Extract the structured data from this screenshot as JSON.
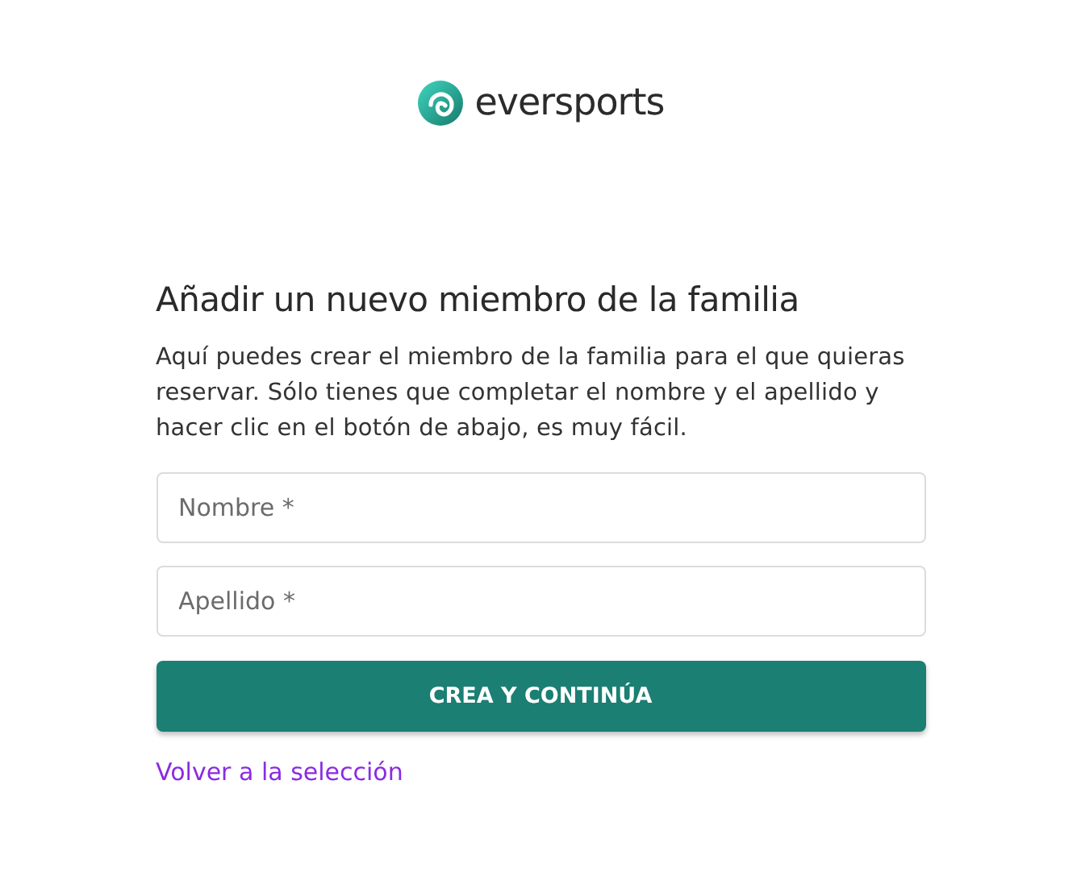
{
  "brand": {
    "name": "eversports"
  },
  "heading": "Añadir un nuevo miembro de la familia",
  "description": "Aquí puedes crear el miembro de la familia para el que quieras reservar. Sólo tienes que completar el nombre y el apellido y hacer clic en el botón de abajo, es muy fácil.",
  "fields": [
    {
      "placeholder": "Nombre *"
    },
    {
      "placeholder": "Apellido *"
    }
  ],
  "submit_button": "CREA Y CONTINÚA",
  "back_link": "Volver a la selección"
}
